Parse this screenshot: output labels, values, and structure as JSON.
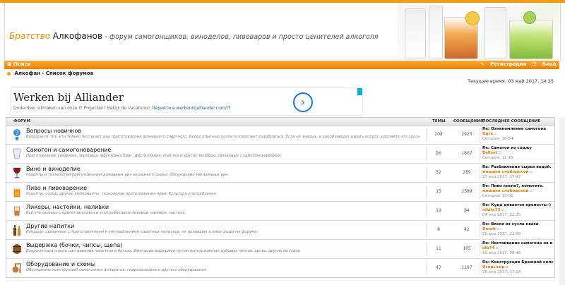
{
  "header": {
    "title_part1": "Братство",
    "title_part2": "Алкофанов",
    "title_part3": " - форум самогонщиков, виноделов, пивоваров и просто ценителей алкоголя"
  },
  "nav": {
    "search": "Поиск",
    "register": "Регистрация",
    "login": "Вход"
  },
  "breadcrumb": {
    "home": "Алкофан",
    "sep": "‹",
    "current": "Список форумов"
  },
  "current_time": "Текущее время: 03 май 2017, 14:25",
  "ad": {
    "title": "Werken bij Alliander",
    "desc": "Onderdeel uitmaken van onze IT Projecten? Bekijk de Vacatures!",
    "link": "Перейти в werkenbijalliander.com/IT",
    "button": "›"
  },
  "table": {
    "col_forum": "ФОРУМ",
    "col_topics": "ТЕМЫ",
    "col_posts": "СООБЩЕНИЯ",
    "col_last": "ПОСЛЕДНЕЕ СООБЩЕНИЕ"
  },
  "forums": [
    {
      "name": "Вопросы новичков",
      "desc": "Вопросы от тех, кто только постигает азы приготовления домашнего спиртного. Более опытные коллеги помогают разобраться. Если не знаешь, в какой раздел задать вопрос, сделайте это здесь.",
      "topics": "208",
      "posts": "2925",
      "last_title": "Re: Ознакомление самогона",
      "last_user": "Ogre",
      "last_date": "Сегодня, 10:54"
    },
    {
      "name": "Самогон и самогоноварение",
      "desc": "Приготовление сахарных, зерновых, фруктовых браг. Дистилляция, очистка и другие вопросы, связанные с самогоноварением.",
      "topics": "96",
      "posts": "1867",
      "last_title": "Re: Самогон из соджу",
      "last_user": "Ballset",
      "last_date": "Сегодня, 11:15"
    },
    {
      "name": "Вино и виноделие",
      "desc": "Рецепты и технология приготовления домашних вин из разного сырья. Обсуждение магазинных вин.",
      "topics": "52",
      "posts": "289",
      "last_title": "Re: Разбавление сырья водой. ...",
      "last_user": "мишини слободской",
      "last_date": "27 апр 2017, 17:42"
    },
    {
      "name": "Пиво и пивоварение",
      "desc": "Рецепты, солод, другие компоненты, технологии приготовления пива. Культура употребления.",
      "topics": "15",
      "posts": "2599",
      "last_title": "Re: Пиво кисне?, помогите.",
      "last_user": "мишини слободской",
      "last_date": "Сегодня, 13:01"
    },
    {
      "name": "Ликеры, настойки, наливки",
      "desc": "Всё что связано с приготовлением и употреблением ликеров, наливок, настоек.",
      "topics": "19",
      "posts": "84",
      "last_title": "Re: Куда девается крепость:-)",
      "last_user": "nikito73",
      "last_date": "04 апр 2017, 22:25"
    },
    {
      "name": "Другие напитки",
      "desc": "Вопросы, связанные с приготовлением и употреблением спиртных напитков, не попавших в иные разделы форума.",
      "topics": "8",
      "posts": "42",
      "last_title": "Re: Виски из сусла кваса",
      "last_user": "Dmatt",
      "last_date": "20 апр 2017, 22:19"
    },
    {
      "name": "Выдержка (бочки, чипсы, щепа)",
      "desc": "Вопросы касательно настаивания напитков в бочках. Имитации выдержки путем использования дубовых чипсов, щепы, других методов.",
      "topics": "11",
      "posts": "105",
      "last_title": "Re: Настаивание самогона на в...",
      "last_user": "alb74",
      "last_date": "15 апр 2017, 08:48"
    },
    {
      "name": "Оборудование и схемы",
      "desc": "Обсуждение конструкций самогонных аппаратов, гидрозатворов и другого оборудования.",
      "topics": "47",
      "posts": "1187",
      "last_title": "Re: Конструкция Бражной колон...",
      "last_user": "Игорь/гор",
      "last_date": "28 апр 2017, 17:18"
    }
  ],
  "icons": [
    "question-icon",
    "glass-icon",
    "wine-icon",
    "beer-icon",
    "liqueur-icon",
    "bottles-icon",
    "barrel-icon",
    "still-icon"
  ],
  "colors": {
    "accent": "#f39c12",
    "user": "#e07b00"
  }
}
